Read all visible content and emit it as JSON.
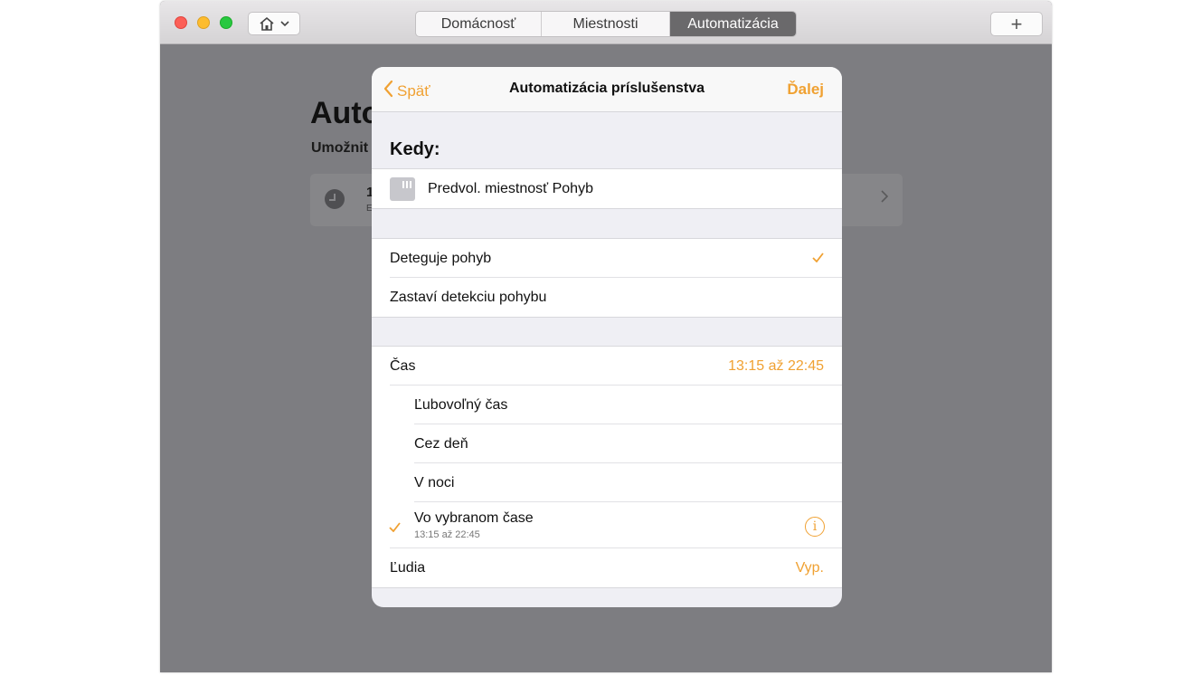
{
  "toolbar": {
    "home_icon": "house-icon",
    "tabs": [
      {
        "label": "Domácnosť",
        "active": false
      },
      {
        "label": "Miestnosti",
        "active": false
      },
      {
        "label": "Automatizácia",
        "active": true
      }
    ],
    "add_label": "+"
  },
  "background": {
    "title": "Auto",
    "subtitle": "Umožnit",
    "card_number": "1",
    "card_small": "E"
  },
  "modal": {
    "back_label": "Späť",
    "title": "Automatizácia príslušenstva",
    "next_label": "Ďalej",
    "section_title": "Kedy:",
    "accessory_name": "Predvol. miestnosť Pohyb",
    "motion_options": [
      {
        "label": "Deteguje pohyb",
        "checked": true
      },
      {
        "label": "Zastaví detekciu pohybu",
        "checked": false
      }
    ],
    "time": {
      "label": "Čas",
      "value": "13:15 až 22:45",
      "options": [
        {
          "label": "Ľubovoľný čas",
          "checked": false
        },
        {
          "label": "Cez deň",
          "checked": false
        },
        {
          "label": "V noci",
          "checked": false
        },
        {
          "label": "Vo vybranom čase",
          "subtitle": "13:15 až 22:45",
          "checked": true
        }
      ]
    },
    "people": {
      "label": "Ľudia",
      "value": "Vyp."
    }
  },
  "colors": {
    "accent": "#f0a132",
    "active_tab": "#6a696b",
    "overlay": "#7d7d81"
  }
}
